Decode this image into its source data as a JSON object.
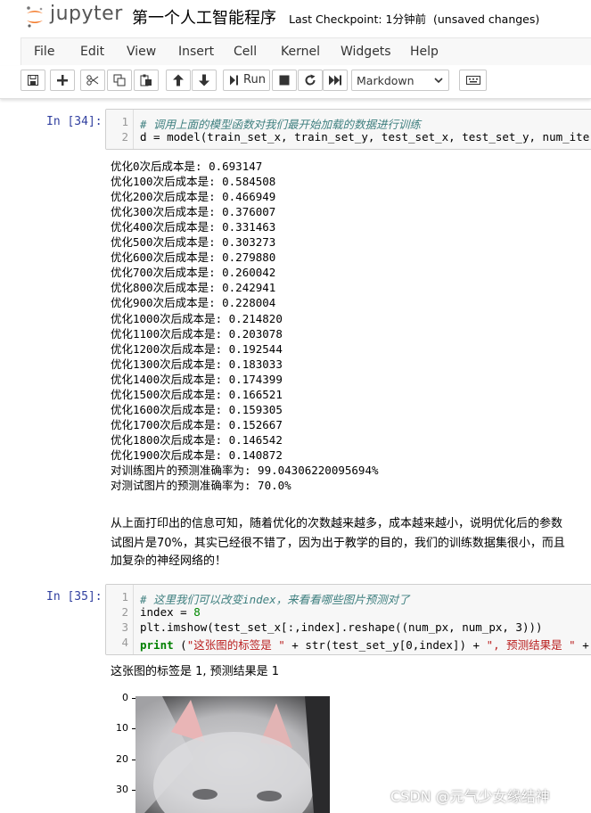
{
  "header": {
    "logo_text": "jupyter",
    "notebook_title": "第一个人工智能程序",
    "checkpoint": "Last Checkpoint: 1分钟前",
    "unsaved": "(unsaved changes)"
  },
  "menu": [
    "File",
    "Edit",
    "View",
    "Insert",
    "Cell",
    "Kernel",
    "Widgets",
    "Help"
  ],
  "toolbar": {
    "run_label": "Run",
    "cell_type": "Markdown",
    "icons": [
      "save-icon",
      "plus-icon",
      "cut-icon",
      "copy-icon",
      "paste-icon",
      "arrow-up-icon",
      "arrow-down-icon",
      "run-icon",
      "stop-icon",
      "restart-icon",
      "fast-forward-icon",
      "keyboard-icon"
    ]
  },
  "cell34": {
    "prompt": "In [34]:",
    "lines": [
      "# 调用上面的模型函数对我们最开始加载的数据进行训练",
      "d = model(train_set_x, train_set_y, test_set_x, test_set_y, num_iteratio"
    ],
    "output": [
      "优化0次后成本是: 0.693147",
      "优化100次后成本是: 0.584508",
      "优化200次后成本是: 0.466949",
      "优化300次后成本是: 0.376007",
      "优化400次后成本是: 0.331463",
      "优化500次后成本是: 0.303273",
      "优化600次后成本是: 0.279880",
      "优化700次后成本是: 0.260042",
      "优化800次后成本是: 0.242941",
      "优化900次后成本是: 0.228004",
      "优化1000次后成本是: 0.214820",
      "优化1100次后成本是: 0.203078",
      "优化1200次后成本是: 0.192544",
      "优化1300次后成本是: 0.183033",
      "优化1400次后成本是: 0.174399",
      "优化1500次后成本是: 0.166521",
      "优化1600次后成本是: 0.159305",
      "优化1700次后成本是: 0.152667",
      "优化1800次后成本是: 0.146542",
      "优化1900次后成本是: 0.140872",
      "对训练图片的预测准确率为: 99.04306220095694%",
      "对测试图片的预测准确率为: 70.0%"
    ]
  },
  "markdown": [
    "从上面打印出的信息可知，随着优化的次数越来越多，成本越来越小，说明优化后的参数",
    "试图片是70%，其实已经很不错了，因为出于教学的目的，我们的训练数据集很小，而且",
    "加复杂的神经网络的！"
  ],
  "cell35": {
    "prompt": "In [35]:",
    "line1": "# 这里我们可以改变index，来看看哪些图片预测对了",
    "line2_a": "index ",
    "line2_b": "= ",
    "line2_c": "8",
    "line3": "plt.imshow(test_set_x[:,index].reshape((num_px, num_px, 3)))",
    "line4_a": "print",
    "line4_b": " (",
    "line4_c": "\"这张图的标签是 \"",
    "line4_d": " + str(test_set_y[0,index]) + ",
    "line4_e": "\", 预测结果是 \"",
    "line4_f": " +",
    "output": "这张图的标签是 1, 预测结果是 1",
    "axis_ticks": [
      "0",
      "10",
      "20",
      "30"
    ]
  },
  "watermark": "CSDN @元气少女缘结神"
}
